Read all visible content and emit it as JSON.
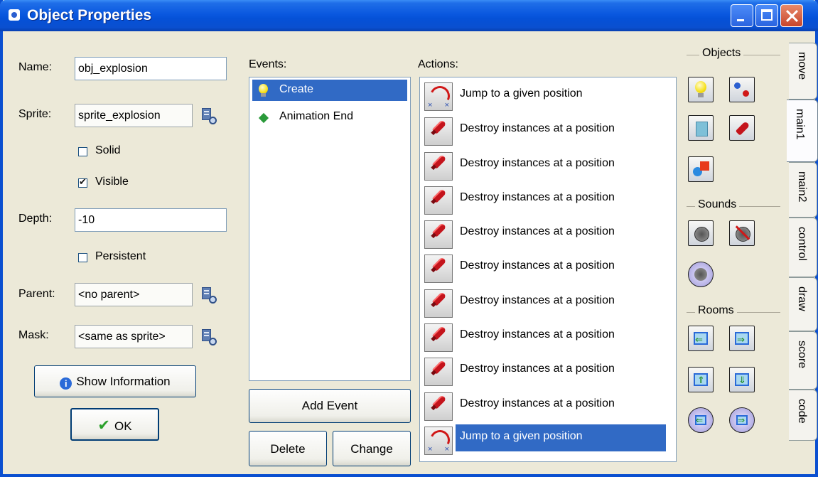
{
  "window": {
    "title": "Object Properties"
  },
  "properties": {
    "name_label": "Name:",
    "name_value": "obj_explosion",
    "sprite_label": "Sprite:",
    "sprite_value": "sprite_explosion",
    "solid_label": "Solid",
    "solid_checked": false,
    "visible_label": "Visible",
    "visible_checked": true,
    "depth_label": "Depth:",
    "depth_value": "-10",
    "persistent_label": "Persistent",
    "persistent_checked": false,
    "parent_label": "Parent:",
    "parent_value": "<no parent>",
    "mask_label": "Mask:",
    "mask_value": "<same as sprite>",
    "show_info_label": "Show Information",
    "ok_label": "OK"
  },
  "events": {
    "title": "Events:",
    "items": [
      {
        "label": "Create",
        "icon": "lightbulb-icon",
        "selected": true
      },
      {
        "label": "Animation End",
        "icon": "green-diamond-icon",
        "selected": false
      }
    ],
    "add_event_label": "Add Event",
    "delete_label": "Delete",
    "change_label": "Change"
  },
  "actions": {
    "title": "Actions:",
    "items": [
      {
        "label": "Jump to a given position",
        "icon": "jump-icon"
      },
      {
        "label": "Destroy instances at a position",
        "icon": "destroy-icon"
      },
      {
        "label": "Destroy instances at a position",
        "icon": "destroy-icon"
      },
      {
        "label": "Destroy instances at a position",
        "icon": "destroy-icon"
      },
      {
        "label": "Destroy instances at a position",
        "icon": "destroy-icon"
      },
      {
        "label": "Destroy instances at a position",
        "icon": "destroy-icon"
      },
      {
        "label": "Destroy instances at a position",
        "icon": "destroy-icon"
      },
      {
        "label": "Destroy instances at a position",
        "icon": "destroy-icon"
      },
      {
        "label": "Destroy instances at a position",
        "icon": "destroy-icon"
      },
      {
        "label": "Destroy instances at a position",
        "icon": "destroy-icon"
      },
      {
        "label": "Jump to a given position",
        "icon": "jump-icon",
        "selected": true
      }
    ]
  },
  "library": {
    "objects_title": "Objects",
    "sounds_title": "Sounds",
    "rooms_title": "Rooms"
  },
  "tabs": [
    {
      "label": "move",
      "active": false
    },
    {
      "label": "main1",
      "active": true
    },
    {
      "label": "main2",
      "active": false
    },
    {
      "label": "control",
      "active": false
    },
    {
      "label": "draw",
      "active": false
    },
    {
      "label": "score",
      "active": false
    },
    {
      "label": "code",
      "active": false
    }
  ]
}
